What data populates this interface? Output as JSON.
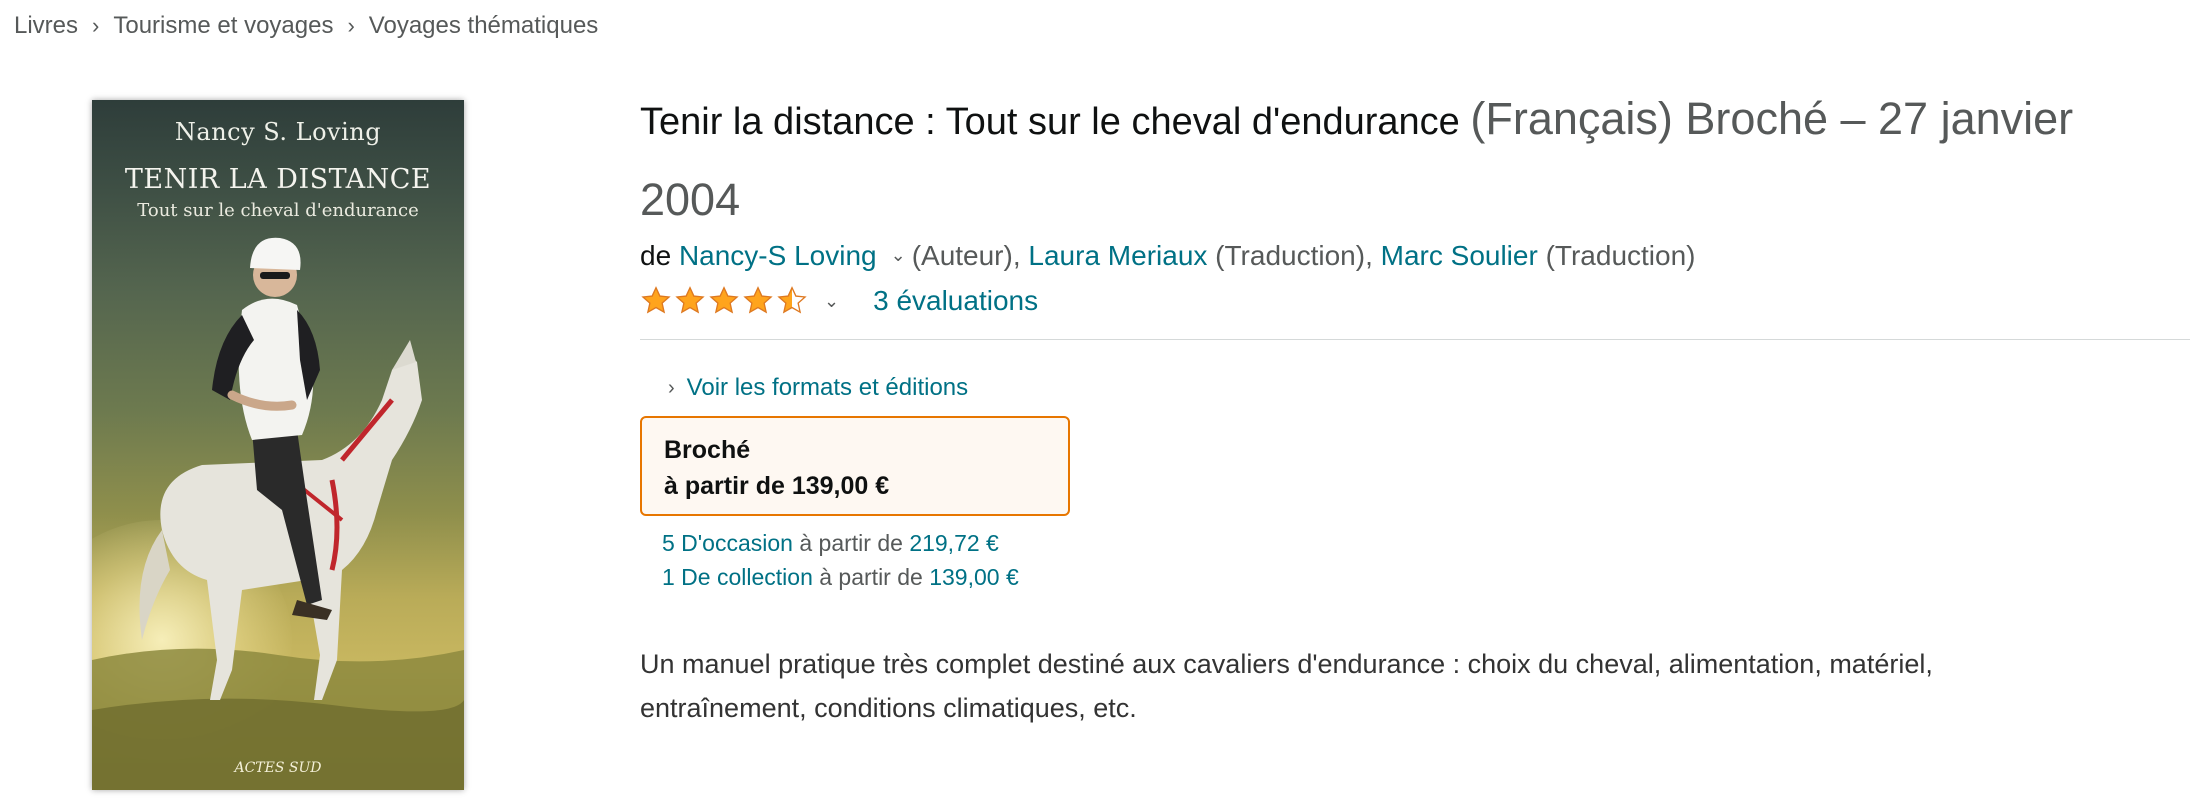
{
  "breadcrumb": {
    "items": [
      "Livres",
      "Tourisme et voyages",
      "Voyages thématiques"
    ],
    "separator": "›"
  },
  "cover": {
    "author": "Nancy S. Loving",
    "title": "TENIR LA DISTANCE",
    "subtitle": "Tout sur le cheval d'endurance",
    "publisher": "ACTES SUD"
  },
  "product": {
    "title": "Tenir la distance : Tout sur le cheval d'endurance",
    "title_meta": "(Français) Broché – 27 janvier 2004",
    "by_label": "de",
    "authors": [
      {
        "name": "Nancy-S Loving",
        "role": "(Auteur),"
      },
      {
        "name": "Laura Meriaux",
        "role": "(Traduction),"
      },
      {
        "name": "Marc Soulier",
        "role": "(Traduction)"
      }
    ],
    "rating": {
      "value": 4.5,
      "max": 5,
      "count_text": "3 évaluations"
    }
  },
  "formats": {
    "link_label": "Voir les formats et éditions",
    "selected": {
      "name": "Broché",
      "price": "à partir de 139,00 €"
    },
    "offers": [
      {
        "label": "5 D'occasion",
        "from": "à partir de",
        "price": "219,72 €"
      },
      {
        "label": "1 De collection",
        "from": "à partir de",
        "price": "139,00 €"
      }
    ]
  },
  "description": "Un manuel pratique très complet destiné aux cavaliers d'endurance : choix du cheval, alimentation, matériel, entraînement, conditions climatiques, etc.",
  "colors": {
    "link": "#007185",
    "text": "#0f1111",
    "muted": "#565959",
    "star": "#ffa41c",
    "format_border": "#e77600"
  },
  "icons": {
    "breadcrumb_separator": "chevron-right-icon",
    "author_menu": "chevron-down-icon",
    "rating_menu": "chevron-down-icon",
    "formats_link": "chevron-right-icon",
    "rating": "star-icon"
  }
}
